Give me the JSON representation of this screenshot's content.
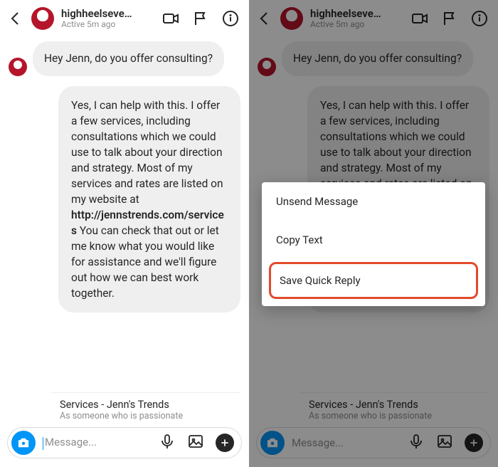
{
  "header": {
    "username": "highheelseve…",
    "status": "Active 5m ago"
  },
  "messages": {
    "incoming": "Hey Jenn, do you offer consulting?",
    "outgoing_pre": "Yes, I can help with this. I offer a few services, including consultations which we could use to talk about your direction and strategy. Most of my services and rates are listed on my website at ",
    "outgoing_link": "http://jennstrends.com/services",
    "outgoing_post": " You can check that out or let me know what you would like for assistance and we'll figure out how we can best work together."
  },
  "preview": {
    "title": "Services - Jenn's Trends",
    "desc": "As someone who is passionate"
  },
  "composer": {
    "placeholder": "Message..."
  },
  "action_sheet": {
    "unsend": "Unsend Message",
    "copy": "Copy Text",
    "save_quick_reply": "Save Quick Reply"
  }
}
